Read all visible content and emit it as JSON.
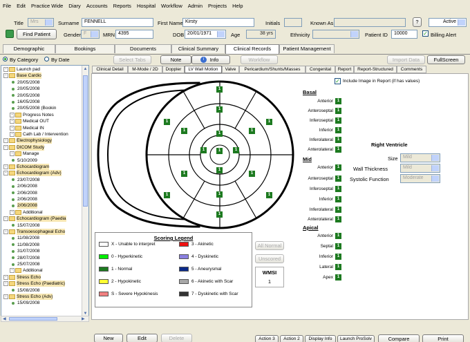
{
  "menu": [
    "File",
    "Edit",
    "Practice Wide",
    "Diary",
    "Accounts",
    "Reports",
    "Hospital",
    "Workflow",
    "Admin",
    "Projects",
    "Help"
  ],
  "patient": {
    "title_label": "Title",
    "title_value": "Mrs",
    "surname_label": "Surname",
    "surname_value": "FENNELL",
    "firstname_label": "First Name",
    "firstname_value": "Kirsty",
    "initials_label": "Initials",
    "initials_value": "",
    "knownas_label": "Known As",
    "knownas_value": "",
    "help_label": "?",
    "status_value": "Active",
    "find_label": "Find Patient",
    "gender_label": "Gender",
    "gender_value": "F",
    "mrn_label": "MRN",
    "mrn_value": "4395",
    "dob_label": "DOB",
    "dob_value": "20/01/1971",
    "age_label": "Age",
    "age_value": "38 yrs",
    "ethnicity_label": "Ethnicity",
    "ethnicity_value": "",
    "patientid_label": "Patient ID",
    "patientid_value": "10000",
    "billing_label": "Billing Alert"
  },
  "main_tabs": [
    "Demographic",
    "Bookings",
    "Documents",
    "Clinical Summary",
    "Clinical Records",
    "Patient Management"
  ],
  "toolbar": {
    "by_category": "By Category",
    "by_date": "By Date",
    "select_tabs": "Select Tabs",
    "note": "Note",
    "info": "Info",
    "workflow": "Workflow",
    "import_data": "Import Data",
    "fullscreen": "FullScreen"
  },
  "tree": [
    {
      "label": "Launch pad",
      "type": "folder",
      "hl": false
    },
    {
      "label": "Base Cardio",
      "type": "folder",
      "hl": true
    },
    {
      "label": "20/05/2008",
      "type": "item",
      "hl": false
    },
    {
      "label": "20/05/2008",
      "type": "item",
      "hl": false
    },
    {
      "label": "20/05/2008",
      "type": "item",
      "hl": false
    },
    {
      "label": "16/05/2008",
      "type": "item",
      "hl": false
    },
    {
      "label": "20/05/2008 (Bookin",
      "type": "item",
      "hl": false
    },
    {
      "label": "Progress Notes",
      "type": "folder",
      "hl": false
    },
    {
      "label": "Medical OUT",
      "type": "folder",
      "hl": false
    },
    {
      "label": "Medical IN",
      "type": "folder",
      "hl": false
    },
    {
      "label": "Cath Lab / Intervention",
      "type": "folder",
      "hl": false
    },
    {
      "label": "Electrophysiology",
      "type": "folder",
      "hl": true
    },
    {
      "label": "DICOM Study",
      "type": "folder",
      "hl": true
    },
    {
      "label": "Manage",
      "type": "folder",
      "hl": false
    },
    {
      "label": "5/10/2009",
      "type": "item",
      "hl": false
    },
    {
      "label": "Echocardiogram",
      "type": "folder",
      "hl": true
    },
    {
      "label": "Echocardiogram (Adv)",
      "type": "folder",
      "hl": true
    },
    {
      "label": "23/07/2008",
      "type": "item",
      "hl": false
    },
    {
      "label": "2/06/2008",
      "type": "item",
      "hl": false
    },
    {
      "label": "2/06/2008",
      "type": "item",
      "hl": false
    },
    {
      "label": "2/06/2008",
      "type": "item",
      "hl": false
    },
    {
      "label": "2/06/2008",
      "type": "item",
      "hl": true
    },
    {
      "label": "Additional",
      "type": "folder",
      "hl": false
    },
    {
      "label": "Echocardiogram (Paedia",
      "type": "folder",
      "hl": true
    },
    {
      "label": "15/07/2008",
      "type": "item",
      "hl": false
    },
    {
      "label": "Transoesophageal Echo",
      "type": "folder",
      "hl": true
    },
    {
      "label": "11/08/2008",
      "type": "item",
      "hl": false
    },
    {
      "label": "11/08/2008",
      "type": "item",
      "hl": false
    },
    {
      "label": "31/07/2008",
      "type": "item",
      "hl": false
    },
    {
      "label": "28/07/2008",
      "type": "item",
      "hl": false
    },
    {
      "label": "25/07/2008",
      "type": "item",
      "hl": false
    },
    {
      "label": "Additional",
      "type": "folder",
      "hl": false
    },
    {
      "label": "Stress Echo",
      "type": "folder",
      "hl": true
    },
    {
      "label": "Stress Echo (Paediatric)",
      "type": "folder",
      "hl": true
    },
    {
      "label": "15/08/2008",
      "type": "item",
      "hl": false
    },
    {
      "label": "Stress Echo (Adv)",
      "type": "folder",
      "hl": true
    },
    {
      "label": "15/09/2008",
      "type": "item",
      "hl": false
    }
  ],
  "sub_tabs": [
    "Clinical Detail",
    "M-Mode / 2D",
    "Doppler",
    "LV Wall Motion",
    "Valve",
    "Pericardium/Shunts/Masses",
    "Congenital",
    "Report",
    "Report-Structured",
    "Comments"
  ],
  "include_image_label": "Include Image in Report (if has values)",
  "bullseye_score": "1",
  "basal": {
    "heading": "Basal",
    "segments": [
      "Anterior",
      "Anteroseptal",
      "Inferoseptal",
      "Inferior",
      "Inferolateral",
      "Anterolateral"
    ],
    "scores": [
      "1",
      "1",
      "1",
      "1",
      "1",
      "1"
    ]
  },
  "mid": {
    "heading": "Mid",
    "segments": [
      "Anterior",
      "Anteroseptal",
      "Inferoseptal",
      "Inferior",
      "Inferolateral",
      "Anterolateral"
    ],
    "scores": [
      "1",
      "1",
      "1",
      "1",
      "1",
      "1"
    ]
  },
  "apical": {
    "heading": "Apical",
    "segments": [
      "Anterior",
      "Septal",
      "Inferior",
      "Lateral",
      "Apex"
    ],
    "scores": [
      "1",
      "1",
      "1",
      "1",
      "1"
    ]
  },
  "right_ventricle": {
    "heading": "Right Ventricle",
    "size_label": "Size",
    "size_value": "Mild",
    "wall_label": "Wall Thickness",
    "wall_value": "Mild",
    "systolic_label": "Systolic Function",
    "systolic_value": "Moderate"
  },
  "legend": {
    "title": "Scoring Legend",
    "items": [
      {
        "label": "X - Unable to interpret",
        "color": "#ffffff"
      },
      {
        "label": "0 - Hyperkinetic",
        "color": "#00ee00"
      },
      {
        "label": "1 - Normal",
        "color": "#1d7a20"
      },
      {
        "label": "2 - Hypokinetic",
        "color": "#ffff33"
      },
      {
        "label": "S - Severe Hypokinesis",
        "color": "#f08080"
      },
      {
        "label": "3 - Akinetic",
        "color": "#ee1111"
      },
      {
        "label": "4 - Dyskinetic",
        "color": "#8a7fe0"
      },
      {
        "label": "5 - Aneurysmal",
        "color": "#0b2a8a"
      },
      {
        "label": "6 - Akinetic with Scar",
        "color": "#a8a8a8"
      },
      {
        "label": "7 - Dyskinetic with Scar",
        "color": "#333333"
      }
    ]
  },
  "all_normal": "All Normal",
  "unscored": "Unscored",
  "wmsi_label": "WMSI",
  "wmsi_value": "1",
  "bottom": {
    "new": "New",
    "edit": "Edit",
    "delete": "Delete",
    "action3": "Action 3",
    "action2": "Action 2",
    "display_info": "Display Info",
    "launch": "Launch ProSolv",
    "compare": "Compare",
    "print": "Print"
  },
  "colors": {
    "normal_green": "#1d7a20",
    "folder": "#f5d77d",
    "highlight": "#f7e7b3"
  }
}
